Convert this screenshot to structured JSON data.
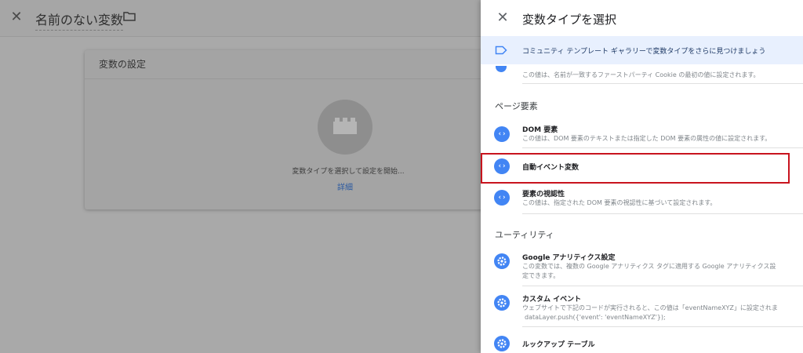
{
  "editor": {
    "title": "名前のない変数",
    "card_header": "変数の設定",
    "placeholder_text": "変数タイプを選択して設定を開始...",
    "details_link": "詳細"
  },
  "panel": {
    "title": "変数タイプを選択",
    "banner_text": "コミュニティ テンプレート ギャラリーで変数タイプをさらに見つけましょう",
    "clipped_desc": "この値は、名前が一致するファーストパーティ Cookie の最初の値に設定されます。",
    "sections": [
      {
        "title": "ページ要素",
        "items": [
          {
            "name": "DOM 要素",
            "desc1": "この値は、DOM 要素のテキストまたは指定した DOM 要素の属性の値に設定されます。",
            "icon": "code-icon"
          },
          {
            "name": "自動イベント変数",
            "desc1": "",
            "icon": "code-icon"
          },
          {
            "name": "要素の視認性",
            "desc1": "この値は、指定された DOM 要素の視認性に基づいて設定されます。",
            "icon": "code-icon"
          }
        ]
      },
      {
        "title": "ユーティリティ",
        "items": [
          {
            "name": "Google アナリティクス設定",
            "desc1": "この変数では、複数の Google アナリティクス タグに適用する Google アナリティクス設",
            "desc2": "定できます。",
            "icon": "gear-icon"
          },
          {
            "name": "カスタム イベント",
            "desc1": "ウェブサイトで下記のコードが実行されると、この値は「eventNameXYZ」に設定されま",
            "desc2": "dataLayer.push({'event': 'eventNameXYZ'});",
            "icon": "gear-icon"
          },
          {
            "name": "ルックアップ テーブル",
            "desc1": "",
            "icon": "gear-icon"
          }
        ]
      }
    ]
  },
  "colors": {
    "accent": "#4285f4",
    "highlight_border": "#c8141e",
    "banner_bg": "#e8f0fe"
  }
}
